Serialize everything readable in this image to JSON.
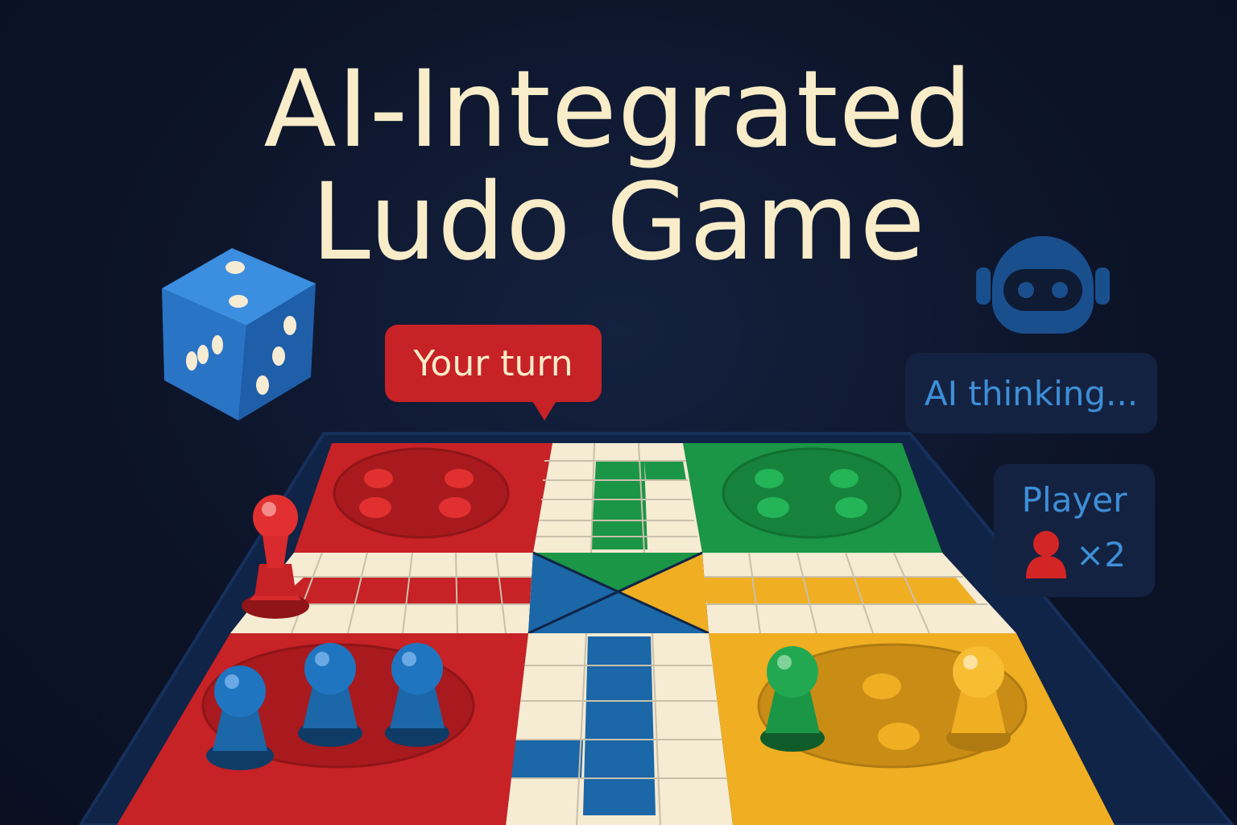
{
  "title": {
    "line1": "AI-Integrated",
    "line2": "Ludo Game"
  },
  "turn_bubble": {
    "text": "Your turn"
  },
  "ai_status": {
    "text": "AI thinking..."
  },
  "player_panel": {
    "label": "Player",
    "count": "×2",
    "icon": "user-icon"
  },
  "icons": {
    "dice": "dice-icon",
    "robot": "robot-icon"
  },
  "colors": {
    "background": "#0c1327",
    "title": "#f8ecc9",
    "red": "#c72226",
    "green": "#1b9546",
    "yellow": "#f0ae22",
    "blue": "#1b67a8",
    "panel": "#142241",
    "accent_text": "#3d8fd8"
  }
}
